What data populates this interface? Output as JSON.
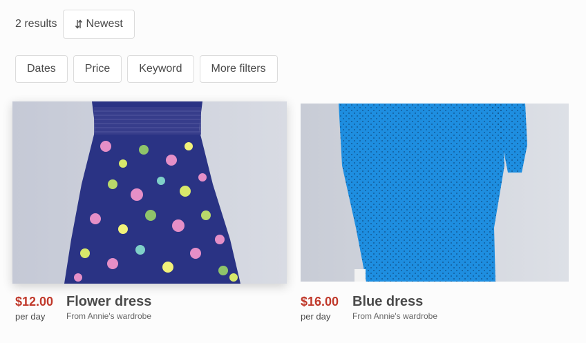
{
  "results_text": "2 results",
  "sort": {
    "label": "Newest",
    "icon": "sort-icon"
  },
  "filters": [
    {
      "label": "Dates"
    },
    {
      "label": "Price"
    },
    {
      "label": "Keyword"
    },
    {
      "label": "More filters"
    }
  ],
  "listings": [
    {
      "price": "$12.00",
      "per": "per day",
      "title": "Flower dress",
      "subtitle": "From Annie's wardrobe"
    },
    {
      "price": "$16.00",
      "per": "per day",
      "title": "Blue dress",
      "subtitle": "From Annie's wardrobe"
    }
  ],
  "colors": {
    "price": "#c0392b",
    "text": "#4a4a4a",
    "border": "#dcdcdc",
    "blue_dress": "#1e8ee0",
    "floral_base": "#2a3384"
  }
}
